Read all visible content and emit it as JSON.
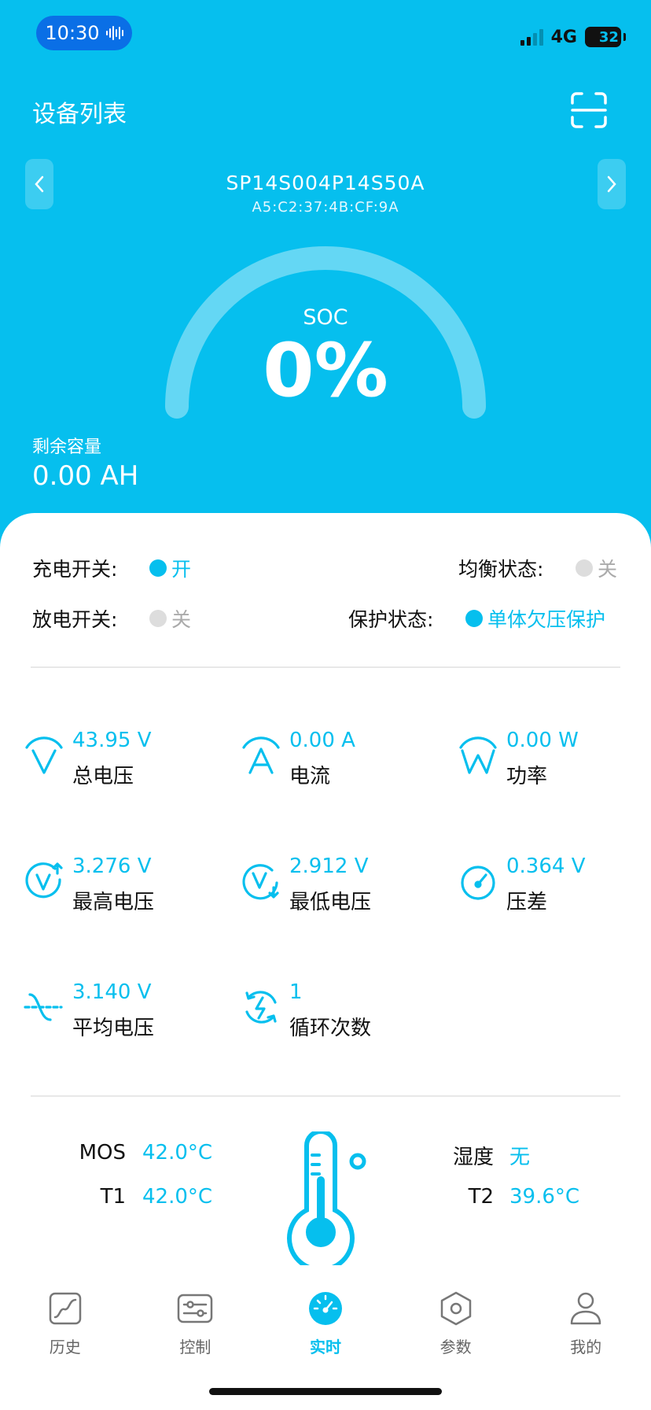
{
  "status_bar": {
    "time": "10:30",
    "network": "4G",
    "battery": "32",
    "battery_level": 0.32
  },
  "header": {
    "title": "设备列表",
    "scan_icon": "scan-icon"
  },
  "device": {
    "name": "SP14S004P14S50A",
    "mac": "A5:C2:37:4B:CF:9A"
  },
  "soc": {
    "label": "SOC",
    "value": "0%"
  },
  "capacity": {
    "label": "剩余容量",
    "value": "0.00 AH"
  },
  "switches": {
    "charge": {
      "label": "充电开关:",
      "value": "开",
      "on": true
    },
    "discharge": {
      "label": "放电开关:",
      "value": "关",
      "on": false
    },
    "balance": {
      "label": "均衡状态:",
      "value": "关",
      "on": false
    },
    "protection": {
      "label": "保护状态:",
      "value": "单体欠压保护",
      "on": true
    }
  },
  "metrics": [
    {
      "value": "43.95 V",
      "label": "总电压",
      "icon": "voltage-icon"
    },
    {
      "value": "0.00 A",
      "label": "电流",
      "icon": "current-icon"
    },
    {
      "value": "0.00 W",
      "label": "功率",
      "icon": "power-icon"
    },
    {
      "value": "3.276 V",
      "label": "最高电压",
      "icon": "max-voltage-icon"
    },
    {
      "value": "2.912 V",
      "label": "最低电压",
      "icon": "min-voltage-icon"
    },
    {
      "value": "0.364 V",
      "label": "压差",
      "icon": "gauge-icon"
    },
    {
      "value": "3.140 V",
      "label": "平均电压",
      "icon": "average-voltage-icon"
    },
    {
      "value": "1",
      "label": "循环次数",
      "icon": "cycle-icon"
    }
  ],
  "temps": {
    "mos": {
      "label": "MOS",
      "value": "42.0°C"
    },
    "t1": {
      "label": "T1",
      "value": "42.0°C"
    },
    "humidity": {
      "label": "湿度",
      "value": "无"
    },
    "t2": {
      "label": "T2",
      "value": "39.6°C"
    },
    "icon": "thermometer-icon"
  },
  "tabs": [
    {
      "label": "历史",
      "icon": "history-chart-icon",
      "active": false
    },
    {
      "label": "控制",
      "icon": "sliders-icon",
      "active": false
    },
    {
      "label": "实时",
      "icon": "dashboard-icon",
      "active": true
    },
    {
      "label": "参数",
      "icon": "hexagon-settings-icon",
      "active": false
    },
    {
      "label": "我的",
      "icon": "user-icon",
      "active": false
    }
  ],
  "colors": {
    "accent": "#06bfee",
    "status_pill": "#0a6fe6",
    "off_dot": "#dddddd"
  }
}
